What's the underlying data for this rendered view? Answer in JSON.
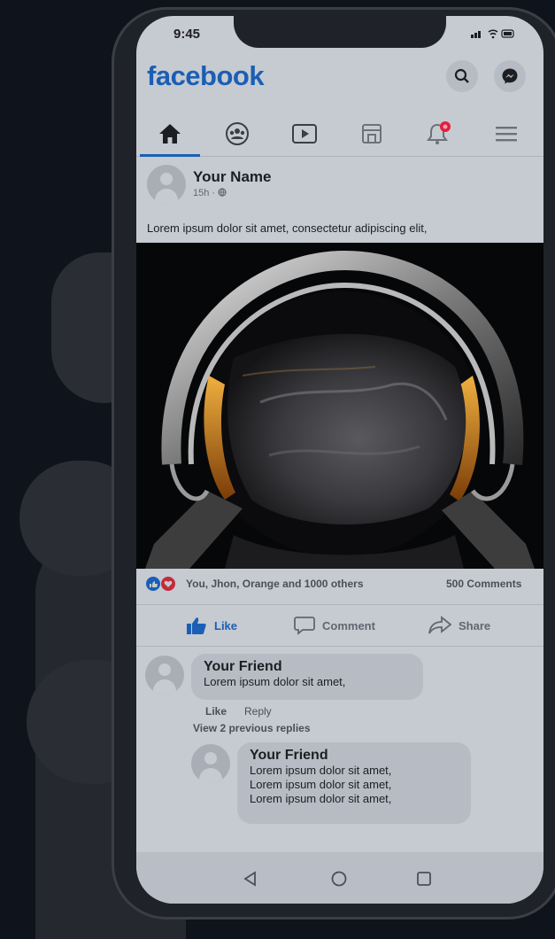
{
  "status_bar": {
    "time": "9:45",
    "icons": "signal wifi battery"
  },
  "header": {
    "logo": "facebook",
    "search_icon": "search-icon",
    "messenger_icon": "messenger-icon"
  },
  "nav": {
    "tabs": [
      "home",
      "groups",
      "watch",
      "marketplace",
      "notifications",
      "menu"
    ],
    "notification_badge": "8"
  },
  "post": {
    "author": "Your Name",
    "meta": "15h · ",
    "text": "Lorem ipsum dolor sit amet, consectetur adipiscing elit,",
    "reactions_text": "You, Jhon, Orange and 1000 others",
    "comments_count": "500 Comments"
  },
  "actions": {
    "like": "Like",
    "comment": "Comment",
    "share": "Share"
  },
  "comments": {
    "first": {
      "author": "Your Friend",
      "text": "Lorem ipsum dolor sit amet,"
    },
    "like_label": "Like",
    "reply_label": "Reply",
    "view_replies": "View 2 previous replies",
    "reply": {
      "author": "Your Friend",
      "lines": [
        "Lorem ipsum dolor sit amet,",
        "Lorem ipsum dolor sit amet,",
        "Lorem ipsum dolor sit amet,"
      ]
    }
  },
  "colors": {
    "brand": "#1b5fb4",
    "background": "#0f131b",
    "screen": "#c6cad1",
    "badge": "#e41e3f"
  }
}
